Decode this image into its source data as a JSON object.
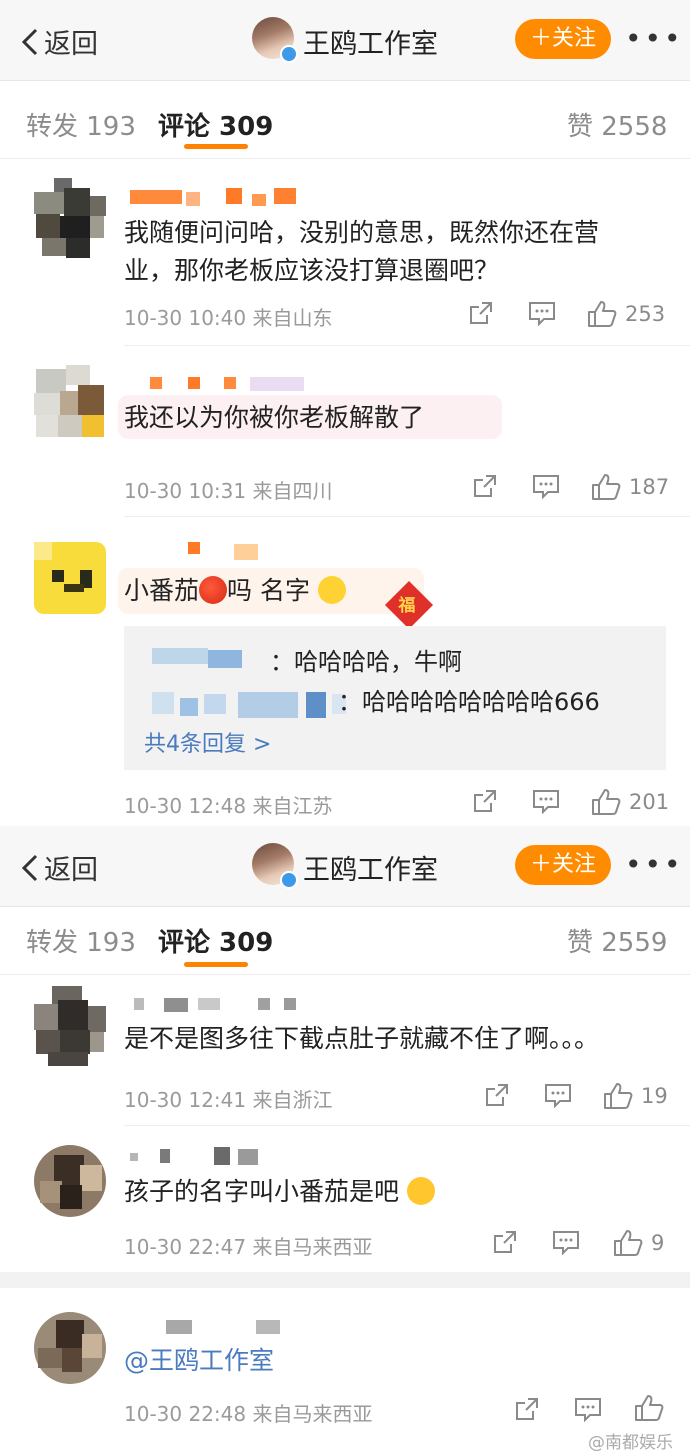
{
  "top_screen": {
    "nav": {
      "back_label": "返回",
      "title": "王鸥工作室",
      "follow_label": "关注",
      "more": "•••"
    },
    "tabs": {
      "repost": "转发 193",
      "comments": "评论 309",
      "likes": "赞 2558"
    },
    "comments": [
      {
        "text": "我随便问问哈，没别的意思，既然你还在营业，那你老板应该没打算退圈吧？",
        "time": "10-30 10:40",
        "source": "来自山东",
        "likes": "253"
      },
      {
        "text": "我还以为你被你老板解散了",
        "time": "10-30 10:31",
        "source": "来自四川",
        "likes": "187"
      },
      {
        "text_a": "小番茄",
        "text_b": "吗 名字",
        "fu_char": "福",
        "replies": [
          "：哈哈哈哈，牛啊",
          "：哈哈哈哈哈哈哈哈666"
        ],
        "reply_more": "共4条回复 >",
        "time": "10-30 12:48",
        "source": "来自江苏",
        "likes": "201"
      }
    ]
  },
  "bottom_screen": {
    "nav": {
      "back_label": "返回",
      "title": "王鸥工作室",
      "follow_label": "关注",
      "more": "•••"
    },
    "tabs": {
      "repost": "转发 193",
      "comments": "评论 309",
      "likes": "赞 2559"
    },
    "comments": [
      {
        "text": "是不是图多往下截点肚子就藏不住了啊。。。",
        "time": "10-30 12:41",
        "source": "来自浙江",
        "likes": "19"
      },
      {
        "text": "孩子的名字叫小番茄是吧",
        "time": "10-30 22:47",
        "source": "来自马来西亚",
        "likes": "9"
      },
      {
        "text": "@王鸥工作室",
        "time": "10-30 22:48",
        "source": "来自马来西亚"
      }
    ]
  },
  "watermark": "@南都娱乐",
  "colors": {
    "accent_orange": "#ff8c00",
    "link_blue": "#4a7bbf",
    "meta_gray": "#9a9a9a"
  },
  "icons": [
    "chevron-left-icon",
    "verified-icon",
    "plus-icon",
    "share-icon",
    "comment-icon",
    "thumbs-up-icon",
    "tomato-emoji",
    "smile-emoji",
    "fu-sticker"
  ]
}
